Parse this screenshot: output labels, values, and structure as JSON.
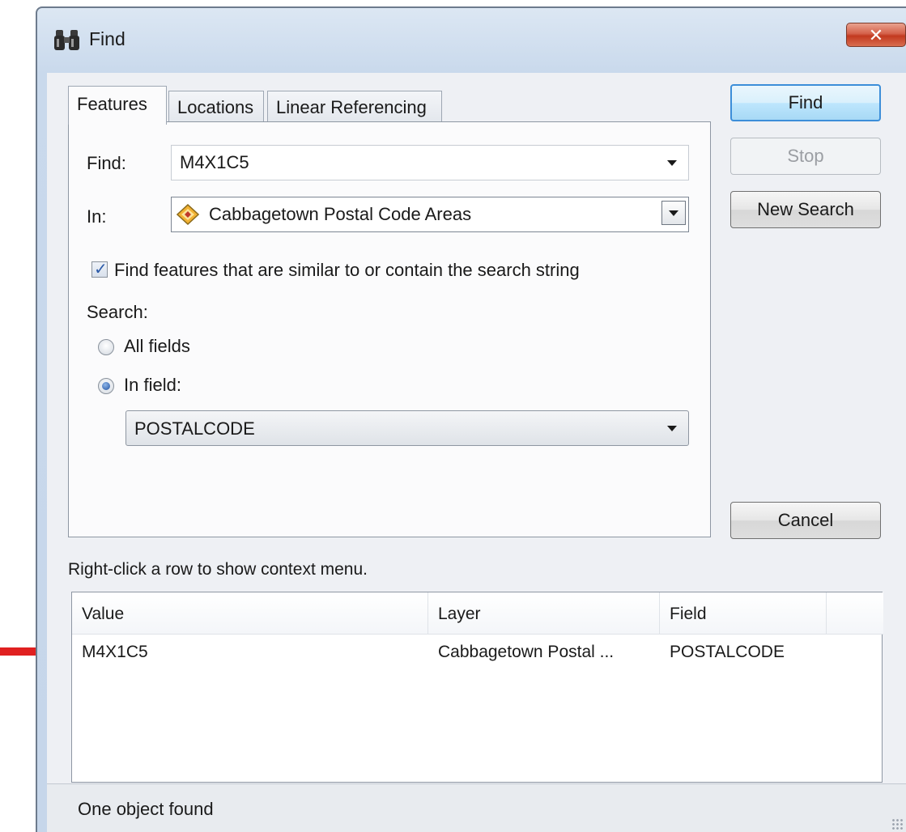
{
  "window": {
    "title": "Find",
    "close_glyph": "✕"
  },
  "tabs": [
    {
      "label": "Features",
      "active": true
    },
    {
      "label": "Locations",
      "active": false
    },
    {
      "label": "Linear Referencing",
      "active": false
    }
  ],
  "form": {
    "find_label": "Find:",
    "find_value": "M4X1C5",
    "in_label": "In:",
    "in_value": "Cabbagetown Postal Code Areas",
    "similar_checkbox_label": "Find features that are similar to or contain the search string",
    "similar_checked": true,
    "search_label": "Search:",
    "radio_all_fields": "All fields",
    "radio_in_field": "In field:",
    "selected_radio": "In field:",
    "field_value": "POSTALCODE"
  },
  "buttons": {
    "find": "Find",
    "stop": "Stop",
    "new_search": "New Search",
    "cancel": "Cancel"
  },
  "hint": "Right-click a row to show context menu.",
  "results": {
    "columns": [
      "Value",
      "Layer",
      "Field"
    ],
    "rows": [
      [
        "M4X1C5",
        "Cabbagetown Postal ...",
        "POSTALCODE"
      ]
    ]
  },
  "status": "One object found",
  "icons": {
    "title": "binoculars-icon",
    "layer": "polygon-layer-icon",
    "annotation": "red-arrow"
  },
  "colors": {
    "annotation_arrow": "#e02020",
    "default_button_border": "#3c8ed9",
    "close_button": "#c2391f"
  }
}
